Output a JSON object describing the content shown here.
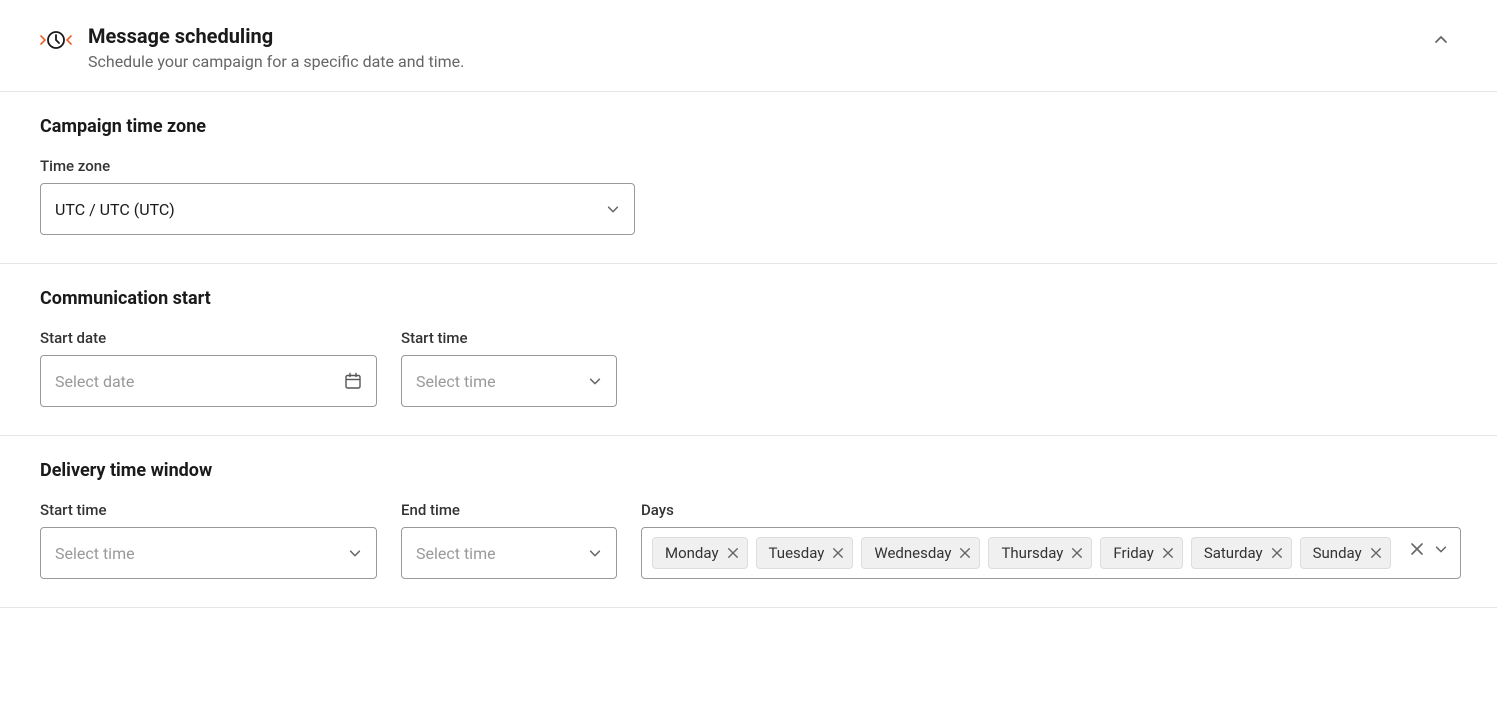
{
  "header": {
    "title": "Message scheduling",
    "subtitle": "Schedule your campaign for a specific date and time."
  },
  "timezone_section": {
    "title": "Campaign time zone",
    "label": "Time zone",
    "value": "UTC / UTC (UTC)"
  },
  "comm_start_section": {
    "title": "Communication start",
    "start_date_label": "Start date",
    "start_date_placeholder": "Select date",
    "start_time_label": "Start time",
    "start_time_placeholder": "Select time"
  },
  "delivery_section": {
    "title": "Delivery time window",
    "start_time_label": "Start time",
    "start_time_placeholder": "Select time",
    "end_time_label": "End time",
    "end_time_placeholder": "Select time",
    "days_label": "Days",
    "days": [
      "Monday",
      "Tuesday",
      "Wednesday",
      "Thursday",
      "Friday",
      "Saturday",
      "Sunday"
    ]
  }
}
